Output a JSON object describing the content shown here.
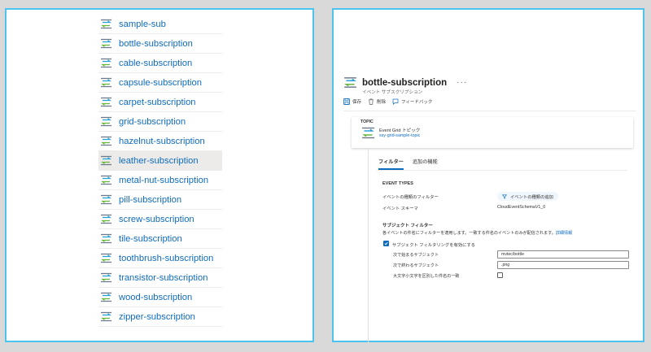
{
  "subscriptions": [
    {
      "label": "sample-sub"
    },
    {
      "label": "bottle-subscription"
    },
    {
      "label": "cable-subscription"
    },
    {
      "label": "capsule-subscription"
    },
    {
      "label": "carpet-subscription"
    },
    {
      "label": "grid-subscription"
    },
    {
      "label": "hazelnut-subscription"
    },
    {
      "label": "leather-subscription",
      "selected": true
    },
    {
      "label": "metal-nut-subscription"
    },
    {
      "label": "pill-subscription"
    },
    {
      "label": "screw-subscription"
    },
    {
      "label": "tile-subscription"
    },
    {
      "label": "toothbrush-subscription"
    },
    {
      "label": "transistor-subscription"
    },
    {
      "label": "wood-subscription"
    },
    {
      "label": "zipper-subscription"
    }
  ],
  "header": {
    "title": "bottle-subscription",
    "subtitle": "イベント サブスクリプション",
    "ellipsis": "···"
  },
  "toolbar": {
    "save_label": "保存",
    "delete_label": "削除",
    "feedback_label": "フィードバック"
  },
  "topic": {
    "label": "TOPIC",
    "type": "Event Grid トピック",
    "name": "ssy-grid-sample-topic"
  },
  "tabs": [
    {
      "label": "フィルター",
      "active": true
    },
    {
      "label": "追加の機能",
      "active": false
    }
  ],
  "filters": {
    "event_types_heading": "EVENT TYPES",
    "event_type_filter_label": "イベントの種類のフィルター",
    "add_event_type_label": "イベントの種類の追加",
    "event_schema_label": "イベント スキーマ",
    "event_schema_value": "CloudEventSchemaV1_0",
    "subject_heading": "サブジェクト フィルター",
    "subject_description": "各イベントの件名にフィルターを適用します。一致する件名のイベントのみが配信されます。",
    "learn_more": "詳細情報",
    "enable_subject_filtering_label": "サブジェクト フィルタリングを有効にする",
    "enable_subject_filtering": true,
    "subject_begins_label": "次で始まるサブジェクト",
    "subject_begins_value": "mvtec/bottle",
    "subject_ends_label": "次で終わるサブジェクト",
    "subject_ends_value": ".png",
    "case_sensitive_label": "大文字小文字を区別した件名の一致",
    "case_sensitive": false
  },
  "colors": {
    "accent": "#0f6cbd",
    "panel_border": "#4dc4ee",
    "selected_row": "#edebe9",
    "background": "#d9d9d9"
  },
  "icons": {
    "subscription": "event-subscription-icon",
    "save": "save-icon",
    "delete": "trash-icon",
    "feedback": "feedback-icon",
    "add": "filter-add-icon",
    "check": "check-icon"
  }
}
